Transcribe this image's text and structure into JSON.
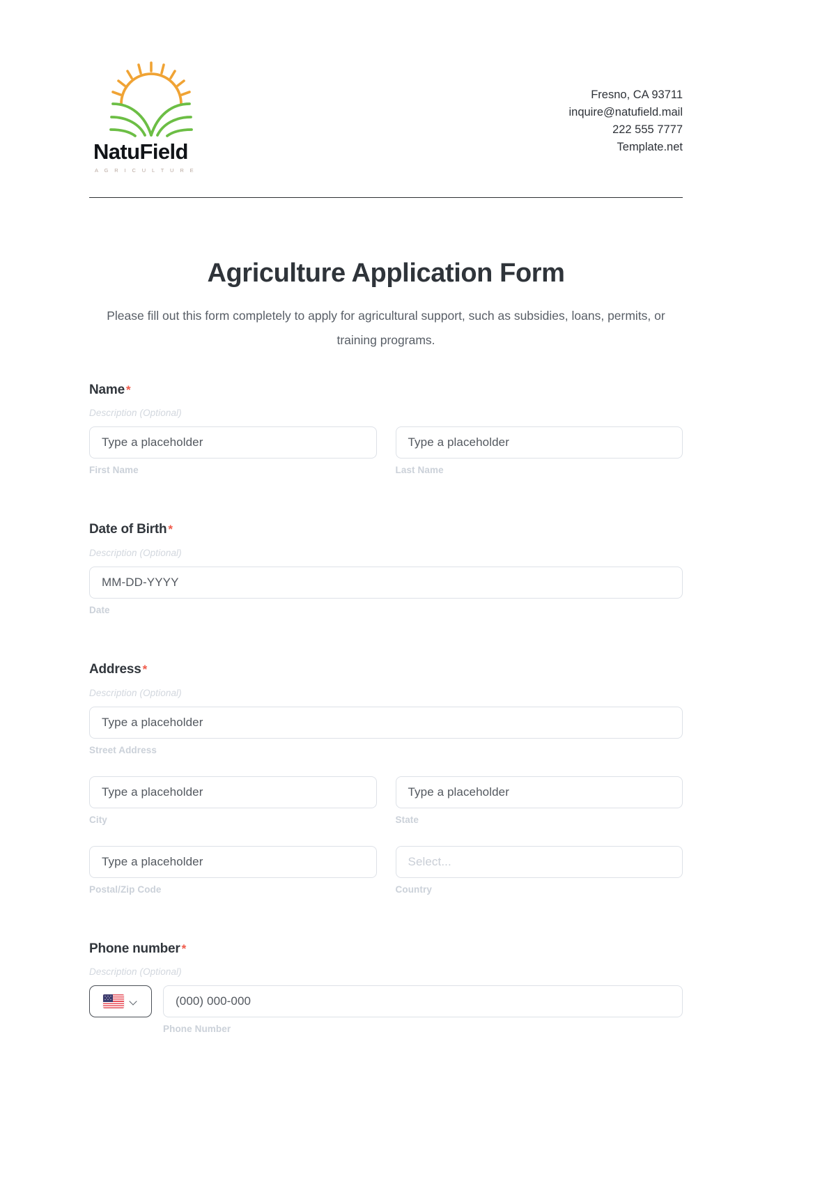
{
  "brand": {
    "name": "NatuField",
    "tagline": "A G R I C U L T U R E",
    "logo_icon": "sun-over-field-icon",
    "colors": {
      "sun": "#f0a334",
      "field": "#6cbe45",
      "text": "#111418"
    }
  },
  "contact": {
    "address": "Fresno, CA 93711",
    "email": "inquire@natufield.mail",
    "phone": "222 555 7777",
    "website": "Template.net"
  },
  "title": "Agriculture Application Form",
  "subtitle": "Please fill out this form completely to apply for agricultural support, such as subsidies, loans, permits, or training programs.",
  "common": {
    "description_placeholder": "Description (Optional)",
    "required_mark": "*",
    "type_placeholder": "Type a placeholder",
    "select_placeholder": "Select..."
  },
  "fields": {
    "name": {
      "label": "Name",
      "description": "Description (Optional)",
      "first": {
        "placeholder": "Type a placeholder",
        "sublabel": "First Name"
      },
      "last": {
        "placeholder": "Type a placeholder",
        "sublabel": "Last Name"
      }
    },
    "dob": {
      "label": "Date of Birth",
      "description": "Description (Optional)",
      "date": {
        "placeholder": "MM-DD-YYYY",
        "sublabel": "Date"
      }
    },
    "address": {
      "label": "Address",
      "description": "Description (Optional)",
      "street": {
        "placeholder": "Type a placeholder",
        "sublabel": "Street Address"
      },
      "city": {
        "placeholder": "Type a placeholder",
        "sublabel": "City"
      },
      "state": {
        "placeholder": "Type a placeholder",
        "sublabel": "State"
      },
      "zip": {
        "placeholder": "Type a placeholder",
        "sublabel": "Postal/Zip Code"
      },
      "country": {
        "placeholder": "Select...",
        "sublabel": "Country"
      }
    },
    "phone": {
      "label": "Phone number",
      "description": "Description (Optional)",
      "country_code_flag": "us-flag-icon",
      "number": {
        "placeholder": "(000) 000-000",
        "sublabel": "Phone Number"
      }
    }
  }
}
